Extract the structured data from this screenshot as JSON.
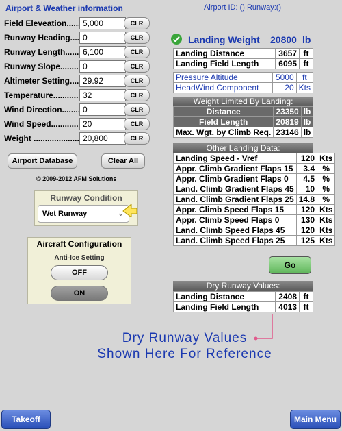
{
  "header": {
    "title": "Airport & Weather information",
    "airport_id": "Airport ID: () Runway:()"
  },
  "fields": [
    {
      "label": "Field Eleveation......",
      "value": "5,000",
      "clr": "CLR"
    },
    {
      "label": "Runway Heading......",
      "value": "0",
      "clr": "CLR"
    },
    {
      "label": "Runway Length.......",
      "value": "6,100",
      "clr": "CLR"
    },
    {
      "label": "Runway Slope.........",
      "value": "0",
      "clr": "CLR"
    },
    {
      "label": "Altimeter Setting.....",
      "value": "29.92",
      "clr": "CLR"
    },
    {
      "label": "Temperature............",
      "value": "32",
      "clr": "CLR"
    },
    {
      "label": "Wind Direction.........",
      "value": "0",
      "clr": "CLR"
    },
    {
      "label": "Wind Speed..............",
      "value": "20",
      "clr": "CLR"
    },
    {
      "label": "Weight .........................",
      "value": "20,800",
      "clr": "CLR"
    }
  ],
  "buttons": {
    "airport_db": "Airport Database",
    "clear_all": "Clear All",
    "go": "Go"
  },
  "copyright": "© 2009-2012 AFM Solutions",
  "runway_condition": {
    "title": "Runway Condition",
    "value": "Wet Runway"
  },
  "aircraft_config": {
    "title": "Aircraft Configuration",
    "subtitle": "Anti-Ice Setting",
    "off": "OFF",
    "on": "ON"
  },
  "landing_weight": {
    "label": "Landing Weight",
    "value": "20800",
    "unit": "lb"
  },
  "landing_rows": [
    {
      "label": "Landing Distance",
      "value": "3657",
      "unit": "ft"
    },
    {
      "label": "Landing Field Length",
      "value": "6095",
      "unit": "ft"
    }
  ],
  "pressure_rows": [
    {
      "label": "Pressure Altitude",
      "value": "5000",
      "unit": "ft"
    },
    {
      "label": "HeadWind Component",
      "value": "20",
      "unit": "Kts"
    }
  ],
  "weight_limited": {
    "title": "Weight Limited By Landing:",
    "rows": [
      {
        "label": "Distance",
        "value": "23350",
        "unit": "lb"
      },
      {
        "label": "Field Length",
        "value": "20819",
        "unit": "lb"
      },
      {
        "label": "Max. Wgt. by Climb Req.",
        "value": "23146",
        "unit": "lb"
      }
    ]
  },
  "other_data": {
    "title": "Other Landing Data:",
    "rows": [
      {
        "label": "Landing Speed - Vref",
        "value": "120",
        "unit": "Kts"
      },
      {
        "label": "Appr. Climb Gradient Flaps 15",
        "value": "3.4",
        "unit": "%"
      },
      {
        "label": "Appr. Climb Gradient Flaps 0",
        "value": "4.5",
        "unit": "%"
      },
      {
        "label": "Land. Climb Gradient Flaps 45",
        "value": "10",
        "unit": "%"
      },
      {
        "label": "Land. Climb Gradient Flaps 25",
        "value": "14.8",
        "unit": "%"
      },
      {
        "label": "Appr. Climb Speed Flaps 15",
        "value": "120",
        "unit": "Kts"
      },
      {
        "label": "Appr. Climb Speed Flaps 0",
        "value": "130",
        "unit": "Kts"
      },
      {
        "label": "Land. Climb Speed Flaps 45",
        "value": "120",
        "unit": "Kts"
      },
      {
        "label": "Land. Climb Speed Flaps 25",
        "value": "125",
        "unit": "Kts"
      }
    ]
  },
  "dry_runway": {
    "title": "Dry Runway Values:",
    "rows": [
      {
        "label": "Landing Distance",
        "value": "2408",
        "unit": "ft"
      },
      {
        "label": "Landing Field Length",
        "value": "4013",
        "unit": "ft"
      }
    ]
  },
  "annotation": {
    "line1": "Dry Runway Values",
    "line2": "Shown Here For Reference"
  },
  "footer": {
    "takeoff": "Takeoff",
    "main_menu": "Main Menu"
  },
  "colors": {
    "title_blue": "#1b39b0",
    "go_green": "#5fb65a",
    "check_green": "#3aa53a"
  }
}
